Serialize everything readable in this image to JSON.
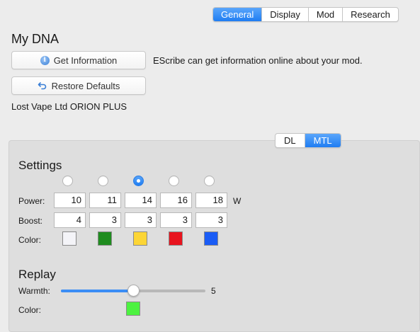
{
  "tabs": {
    "items": [
      {
        "label": "General",
        "active": true
      },
      {
        "label": "Display",
        "active": false
      },
      {
        "label": "Mod",
        "active": false
      },
      {
        "label": "Research",
        "active": false
      }
    ]
  },
  "my_dna": {
    "title": "My DNA",
    "get_info_label": "Get Information",
    "get_info_desc": "EScribe can get information online about your mod.",
    "restore_label": "Restore Defaults",
    "device_name": "Lost Vape Ltd ORION PLUS"
  },
  "material_tabs": {
    "items": [
      {
        "label": "DL",
        "active": false
      },
      {
        "label": "MTL",
        "active": true
      }
    ]
  },
  "settings": {
    "title": "Settings",
    "selected_index": 2,
    "power_label": "Power:",
    "power_unit": "W",
    "power_values": [
      "10",
      "11",
      "14",
      "16",
      "18"
    ],
    "boost_label": "Boost:",
    "boost_values": [
      "4",
      "3",
      "3",
      "3",
      "3"
    ],
    "color_label": "Color:",
    "colors": [
      "#f4f4f8",
      "#1f8c1f",
      "#fcd535",
      "#e8141e",
      "#1a5cf5"
    ]
  },
  "replay": {
    "title": "Replay",
    "warmth_label": "Warmth:",
    "warmth_value": "5",
    "warmth_min": 0,
    "warmth_max": 10,
    "color_label": "Color:",
    "color": "#4cf240"
  },
  "colors": {
    "accent": "#1f7df2",
    "window_bg": "#ececec",
    "panel_bg": "#dedede"
  }
}
